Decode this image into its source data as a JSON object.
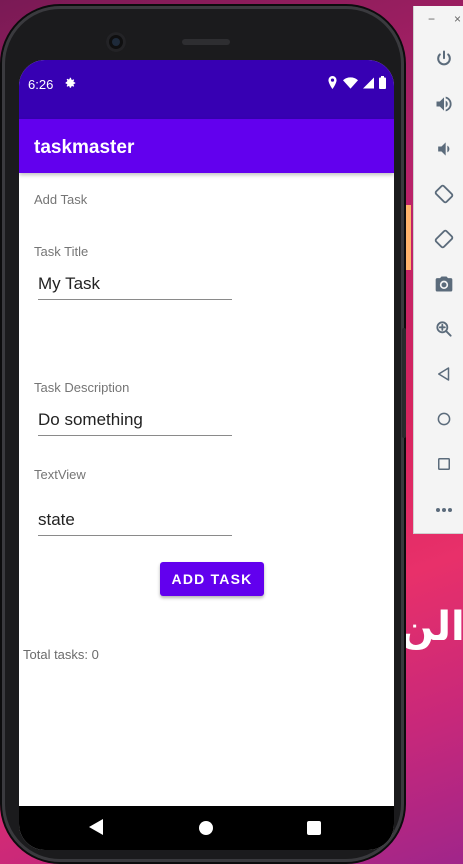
{
  "status_bar": {
    "time": "6:26"
  },
  "app_bar": {
    "title": "taskmaster"
  },
  "form": {
    "heading": "Add Task",
    "task_title_label": "Task Title",
    "task_title_value": "My Task",
    "task_description_label": "Task Description",
    "task_description_value": "Do something",
    "state_label": "TextView",
    "state_value": "state",
    "submit_label": "ADD TASK",
    "total_tasks": "Total tasks: 0"
  },
  "emulator": {
    "minimize": "−",
    "close": "×"
  },
  "desktop": {
    "arabic_text": "الن"
  },
  "colors": {
    "status_bar": "#3700b3",
    "app_bar": "#6200ee",
    "accent": "#6200ee"
  },
  "icons": [
    "gear-icon",
    "location-icon",
    "wifi-icon",
    "signal-icon",
    "battery-icon",
    "back-icon",
    "home-icon",
    "recents-icon",
    "power-icon",
    "volume-up-icon",
    "volume-down-icon",
    "rotate-left-icon",
    "rotate-right-icon",
    "camera-icon",
    "zoom-icon",
    "back-triangle-icon",
    "home-circle-icon",
    "overview-square-icon",
    "more-icon"
  ]
}
